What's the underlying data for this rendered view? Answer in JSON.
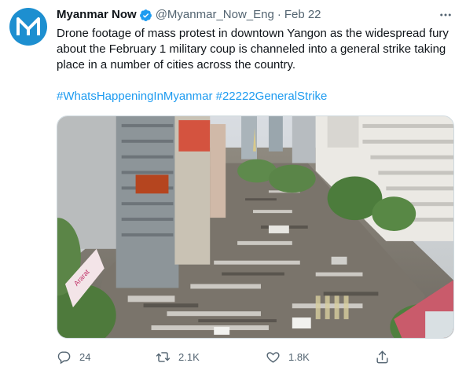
{
  "tweet": {
    "author_name": "Myanmar Now",
    "author_handle": "@Myanmar_Now_Eng",
    "separator": "·",
    "date": "Feb 22",
    "verified": true,
    "text": "Drone footage of mass protest in downtown Yangon as the widespread fury about the February 1 military coup is channeled into a general strike taking place in a number of cities across the country.",
    "hashtags": [
      "#WhatsHappeningInMyanmar",
      "#22222GeneralStrike"
    ],
    "media_sign_text": "Ararat"
  },
  "actions": {
    "reply_count": "24",
    "retweet_count": "2.1K",
    "like_count": "1.8K"
  },
  "colors": {
    "brand_blue": "#1d8fd0",
    "link": "#1d9bf0",
    "muted": "#536471"
  },
  "icons": {
    "avatar": "myanmar-now-logo",
    "verified": "verified-badge-icon",
    "more": "more-dots-icon",
    "reply": "reply-icon",
    "retweet": "retweet-icon",
    "like": "heart-icon",
    "share": "share-icon"
  }
}
